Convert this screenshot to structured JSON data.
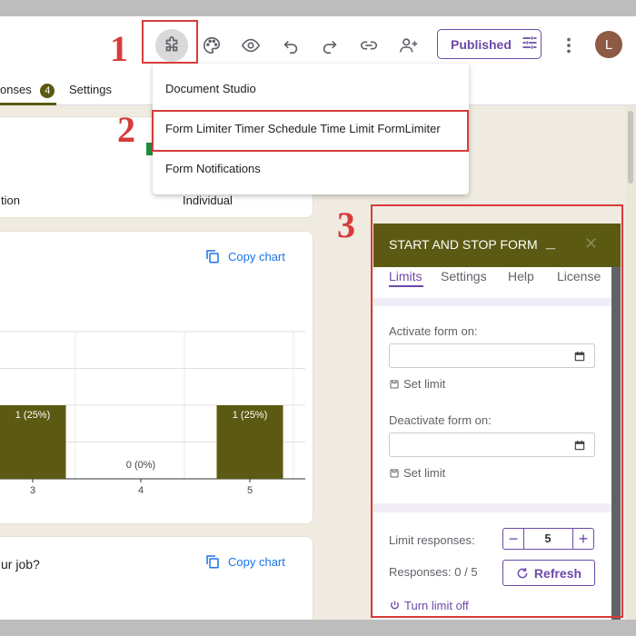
{
  "toolbar": {
    "published_label": "Published",
    "avatar_letter": "L",
    "icons": [
      "puzzle-icon",
      "palette-icon",
      "eye-icon",
      "undo-icon",
      "redo-icon",
      "link-icon",
      "add-person-icon",
      "tune-icon",
      "more-vert-icon"
    ]
  },
  "tabs": {
    "responses_label": "onses",
    "responses_count": "4",
    "settings_label": "Settings"
  },
  "addon_menu": {
    "items": [
      "Document Studio",
      "Form Limiter Timer Schedule Time Limit FormLimiter",
      "Form Notifications"
    ]
  },
  "summary": {
    "left_text": "tion",
    "right_text": "Individual"
  },
  "chart_card": {
    "copy_label": "Copy chart"
  },
  "chart_data": {
    "type": "bar",
    "categories": [
      "3",
      "4",
      "5"
    ],
    "values": [
      1,
      0,
      1
    ],
    "labels": [
      "1 (25%)",
      "0 (0%)",
      "1 (25%)"
    ],
    "bar_color": "#5c5a12"
  },
  "question_card": {
    "question_text": "ur job?",
    "copy_label": "Copy chart"
  },
  "annotations": {
    "step1": "1",
    "step2": "2",
    "step3": "3"
  },
  "panel": {
    "title": "START AND STOP FORM",
    "minimize": "_",
    "close": "✕",
    "tabs": [
      "Limits",
      "Settings",
      "Help",
      "License"
    ],
    "activate_label": "Activate form on:",
    "deactivate_label": "Deactivate form on:",
    "set_limit_label": "Set limit",
    "limit_responses_label": "Limit responses:",
    "limit_value": "5",
    "responses_status": "Responses: 0 / 5",
    "refresh_label": "Refresh",
    "turn_off_label": "Turn limit off"
  },
  "colors": {
    "accent_olive": "#5c5a12",
    "accent_purple": "#6b4aa8",
    "annotation_red": "#d83b3b",
    "link_blue": "#1a73e8"
  }
}
